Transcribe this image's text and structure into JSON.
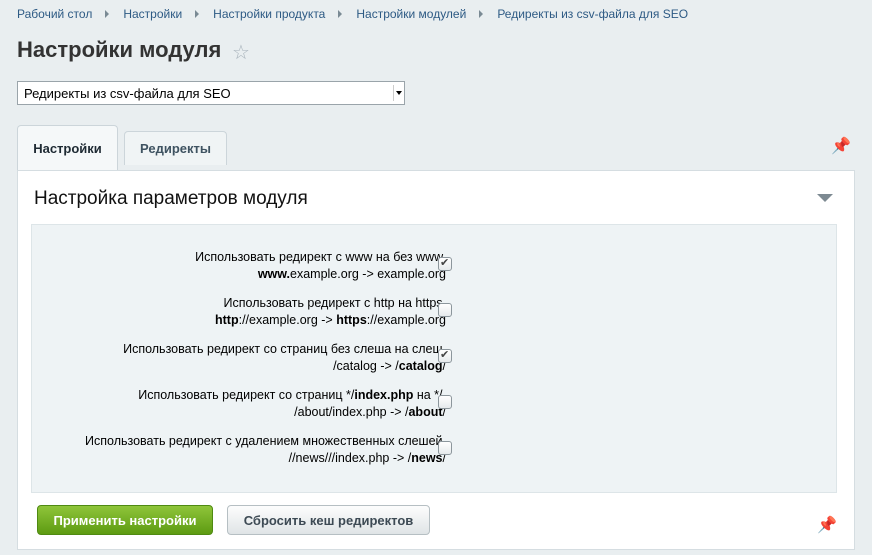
{
  "breadcrumb": [
    "Рабочий стол",
    "Настройки",
    "Настройки продукта",
    "Настройки модулей",
    "Редиректы из csv-файла для SEO"
  ],
  "page_title": "Настройки модуля",
  "module_select": {
    "selected": "Редиректы из csv-файла для SEO"
  },
  "tabs": [
    {
      "label": "Настройки",
      "active": true
    },
    {
      "label": "Редиректы",
      "active": false
    }
  ],
  "section_title": "Настройка параметров модуля",
  "options": [
    {
      "line1": "Использовать редирект с www на без www,",
      "line2_html": "<b>www.</b>example.org -&gt; example.org",
      "line2": "www.example.org -> example.org",
      "checked": true
    },
    {
      "line1": "Использовать редирект с http на https,",
      "line2_html": "<b>http</b>://example.org -&gt; <b>https</b>://example.org",
      "line2": "http://example.org -> https://example.org",
      "checked": false
    },
    {
      "line1": "Использовать редирект со страниц без слеша на слеш,",
      "line2_html": "/catalog -&gt; /<b>catalog</b>/",
      "line2": "/catalog -> /catalog/",
      "checked": true
    },
    {
      "line1_html": "Использовать редирект со страниц */<b>index.php</b> на */,",
      "line1": "Использовать редирект со страниц */index.php на */,",
      "line2_html": "/about/index.php -&gt; /<b>about</b>/",
      "line2": "/about/index.php -> /about/",
      "checked": false
    },
    {
      "line1": "Использовать редирект с удалением множественных слешей,",
      "line2_html": "//news///index.php -&gt; /<b>news</b>/",
      "line2": "//news///index.php -> /news/",
      "checked": false
    }
  ],
  "buttons": {
    "apply": "Применить настройки",
    "reset": "Сбросить кеш редиректов"
  },
  "icons": {
    "star": "star-icon",
    "pin": "pin-icon",
    "collapse": "collapse-icon"
  },
  "colors": {
    "apply_button": "#6fae1e",
    "link": "#2d5a84"
  }
}
